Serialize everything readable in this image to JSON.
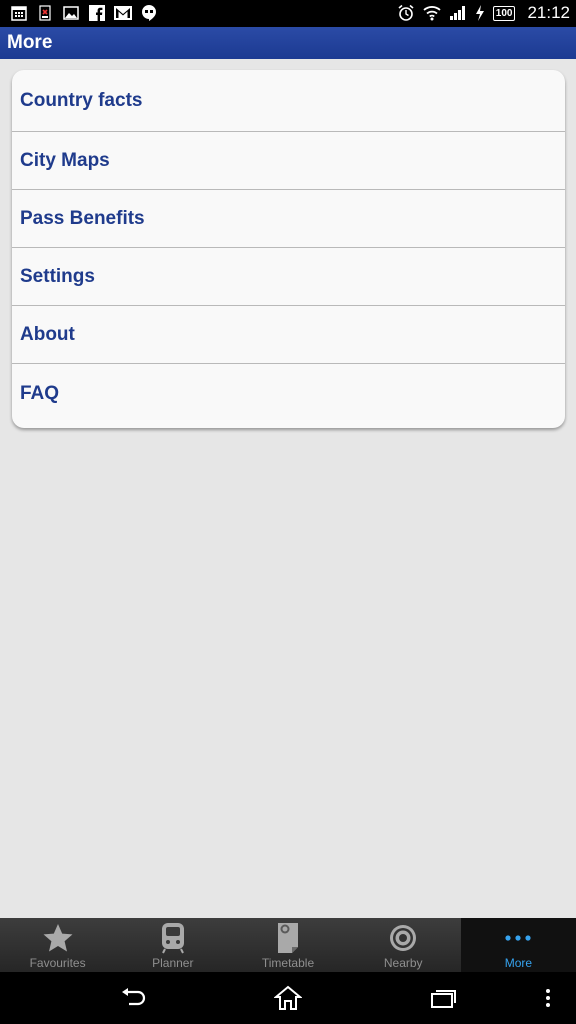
{
  "status_bar": {
    "time": "21:12",
    "battery": "100",
    "left_icons": [
      "calendar-icon",
      "sim-alert-icon",
      "image-icon",
      "facebook-icon",
      "gmail-icon",
      "hangouts-icon"
    ],
    "right_icons": [
      "alarm-icon",
      "wifi-icon",
      "signal-icon",
      "charging-icon",
      "battery-icon"
    ]
  },
  "header": {
    "title": "More"
  },
  "menu": {
    "items": [
      {
        "label": "Country facts"
      },
      {
        "label": "City Maps"
      },
      {
        "label": "Pass Benefits"
      },
      {
        "label": "Settings"
      },
      {
        "label": "About"
      },
      {
        "label": "FAQ"
      }
    ]
  },
  "tabs": [
    {
      "label": "Favourites",
      "icon": "star-icon",
      "active": false
    },
    {
      "label": "Planner",
      "icon": "train-icon",
      "active": false
    },
    {
      "label": "Timetable",
      "icon": "timetable-icon",
      "active": false
    },
    {
      "label": "Nearby",
      "icon": "target-icon",
      "active": false
    },
    {
      "label": "More",
      "icon": "more-dots-icon",
      "active": true
    }
  ],
  "nav_bar": {
    "icons": [
      "back-icon",
      "home-icon",
      "recent-apps-icon",
      "menu-icon"
    ]
  },
  "colors": {
    "title_bar": "#1c3a92",
    "menu_text": "#1f3b8c",
    "active_tab": "#36a3ef",
    "background": "#e6e6e6"
  }
}
